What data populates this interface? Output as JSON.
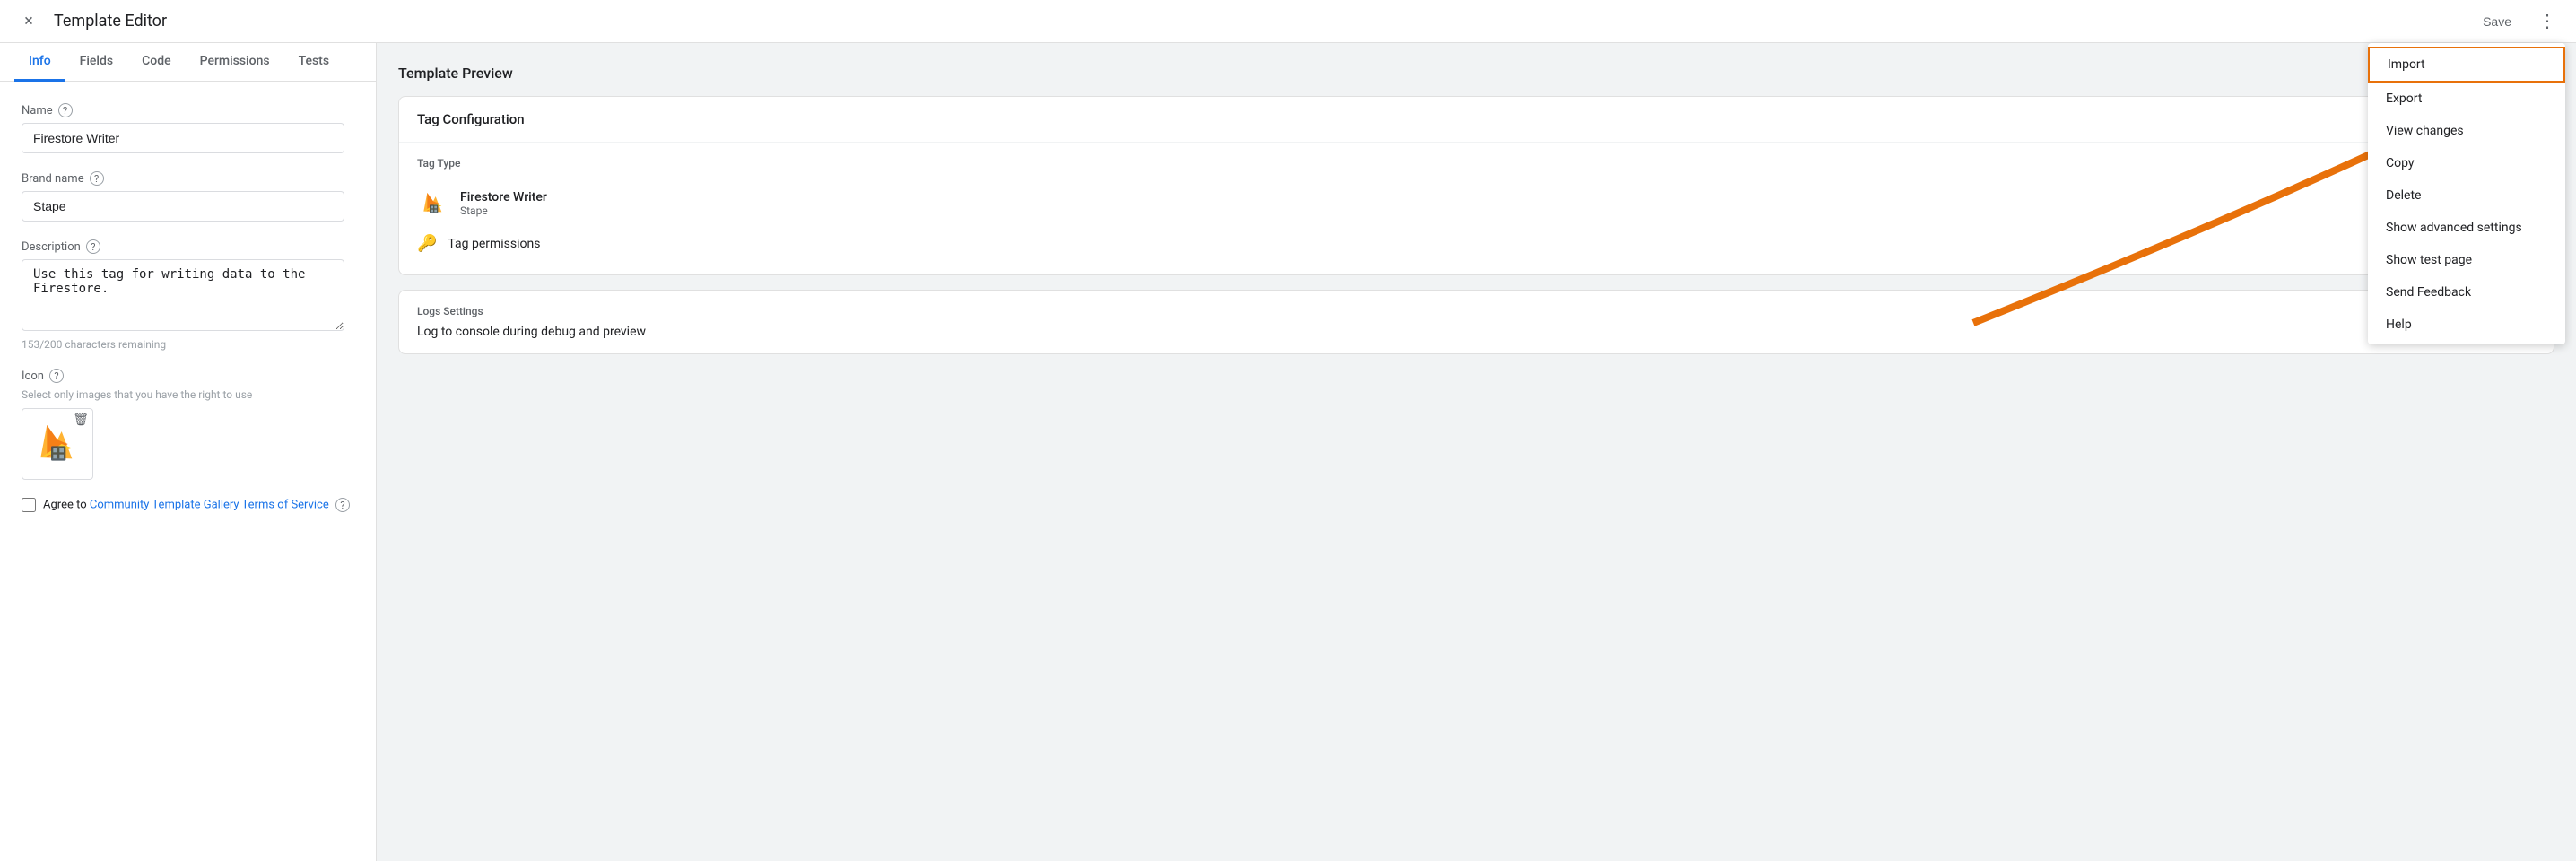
{
  "header": {
    "title": "Template Editor",
    "save_label": "Save",
    "close_icon": "×",
    "more_icon": "⋮"
  },
  "tabs": [
    {
      "label": "Info",
      "active": true
    },
    {
      "label": "Fields",
      "active": false
    },
    {
      "label": "Code",
      "active": false
    },
    {
      "label": "Permissions",
      "active": false
    },
    {
      "label": "Tests",
      "active": false
    }
  ],
  "form": {
    "name_label": "Name",
    "name_value": "Firestore Writer",
    "brand_label": "Brand name",
    "brand_value": "Stape",
    "description_label": "Description",
    "description_value": "Use this tag for writing data to the Firestore.",
    "char_count": "153/200 characters remaining",
    "icon_label": "Icon",
    "icon_hint": "Select only images that you have the right to use",
    "agree_text": "Agree to",
    "agree_link": "Community Template Gallery Terms of Service"
  },
  "preview": {
    "title": "Template Preview",
    "tag_config_title": "Tag Configuration",
    "tag_type_label": "Tag Type",
    "tag_name": "Firestore Writer",
    "tag_brand": "Stape",
    "permissions_label": "Tag permissions",
    "logs_title": "Logs Settings",
    "logs_text": "Log to console during debug and preview"
  },
  "dropdown": {
    "items": [
      {
        "label": "Import",
        "highlighted": true
      },
      {
        "label": "Export",
        "highlighted": false
      },
      {
        "label": "View changes",
        "highlighted": false
      },
      {
        "label": "Copy",
        "highlighted": false
      },
      {
        "label": "Delete",
        "highlighted": false
      },
      {
        "label": "Show advanced settings",
        "highlighted": false
      },
      {
        "label": "Show test page",
        "highlighted": false
      },
      {
        "label": "Send Feedback",
        "highlighted": false
      },
      {
        "label": "Help",
        "highlighted": false
      }
    ]
  },
  "colors": {
    "active_tab": "#1a73e8",
    "link": "#1a73e8",
    "arrow": "#e8710a",
    "highlight_border": "#e8710a"
  }
}
